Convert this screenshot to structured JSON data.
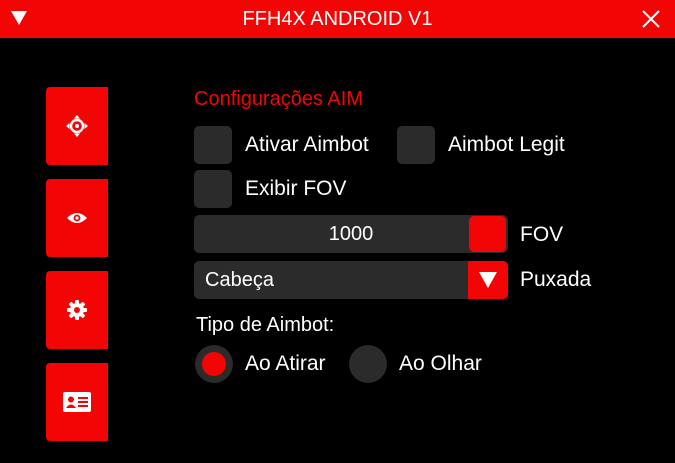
{
  "window": {
    "title": "FFH4X ANDROID V1"
  },
  "sidebar": {
    "items": [
      {
        "icon": "crosshair-icon"
      },
      {
        "icon": "eye-icon"
      },
      {
        "icon": "gear-icon"
      },
      {
        "icon": "id-card-icon"
      }
    ]
  },
  "aim": {
    "section_title": "Configurações AIM",
    "ativar_aimbot": {
      "label": "Ativar Aimbot",
      "checked": false
    },
    "aimbot_legit": {
      "label": "Aimbot Legit",
      "checked": false
    },
    "exibir_fov": {
      "label": "Exibir FOV",
      "checked": false
    },
    "fov": {
      "value": "1000",
      "label": "FOV",
      "color": "#f40505"
    },
    "puxada": {
      "selected": "Cabeça",
      "label": "Puxada"
    },
    "tipo_aimbot": {
      "label": "Tipo de Aimbot:",
      "options": [
        {
          "label": "Ao Atirar",
          "selected": true
        },
        {
          "label": "Ao Olhar",
          "selected": false
        }
      ]
    }
  },
  "colors": {
    "accent": "#f40505",
    "control_bg": "#2b2b2b",
    "background": "#000000"
  }
}
